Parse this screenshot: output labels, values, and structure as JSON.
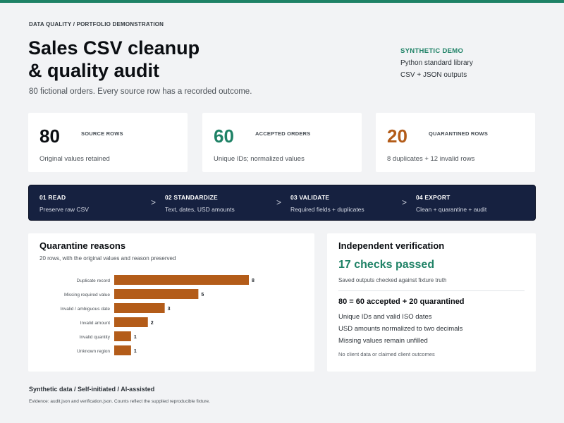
{
  "colors": {
    "accent": "#1f8266",
    "amber": "#b35c19",
    "bar": "#b35c19",
    "pipeline_bg": "#162140",
    "top_bar": "#1f8266"
  },
  "header": {
    "eyebrow": "DATA QUALITY / PORTFOLIO DEMONSTRATION",
    "title_line1": "Sales CSV cleanup",
    "title_line2": "& quality audit",
    "subtitle": "80 fictional orders. Every source row has a recorded outcome."
  },
  "demo": {
    "label": "SYNTHETIC DEMO",
    "line1": "Python standard library",
    "line2": "CSV + JSON outputs"
  },
  "stats": [
    {
      "value": "80",
      "label": "SOURCE ROWS",
      "desc": "Original values retained"
    },
    {
      "value": "60",
      "label": "ACCEPTED ORDERS",
      "desc": "Unique IDs; normalized values"
    },
    {
      "value": "20",
      "label": "QUARANTINED ROWS",
      "desc": "8 duplicates + 12 invalid rows"
    }
  ],
  "pipeline": {
    "stages": [
      {
        "title": "01  READ",
        "desc": "Preserve raw CSV"
      },
      {
        "title": "02  STANDARDIZE",
        "desc": "Text, dates, USD amounts"
      },
      {
        "title": "03  VALIDATE",
        "desc": "Required fields + duplicates"
      },
      {
        "title": "04  EXPORT",
        "desc": "Clean + quarantine + audit"
      }
    ],
    "arrow": ">"
  },
  "quarantine": {
    "title": "Quarantine reasons",
    "subtitle": "20 rows, with the original values and reason preserved"
  },
  "chart_data": {
    "type": "bar",
    "orientation": "horizontal",
    "categories": [
      "Duplicate record",
      "Missing required value",
      "Invalid / ambiguous date",
      "Invalid amount",
      "Invalid quantity",
      "Unknown region"
    ],
    "values": [
      8,
      5,
      3,
      2,
      1,
      1
    ],
    "title": "Quarantine reasons",
    "xlabel": "",
    "ylabel": "",
    "xlim": [
      0,
      8
    ],
    "grid": false,
    "data_labels": true
  },
  "verification": {
    "title": "Independent verification",
    "headline": "17 checks passed",
    "note": "Saved outputs checked against fixture truth",
    "equation": "80 = 60 accepted + 20 quarantined",
    "items": [
      "Unique IDs and valid ISO dates",
      "USD amounts normalized to two decimals",
      "Missing values remain unfilled"
    ],
    "footnote": "No client data or claimed client outcomes"
  },
  "footer": {
    "title": "Synthetic data / Self-initiated / AI-assisted",
    "note": "Evidence: audit.json and verification.json. Counts reflect the supplied reproducible fixture."
  }
}
